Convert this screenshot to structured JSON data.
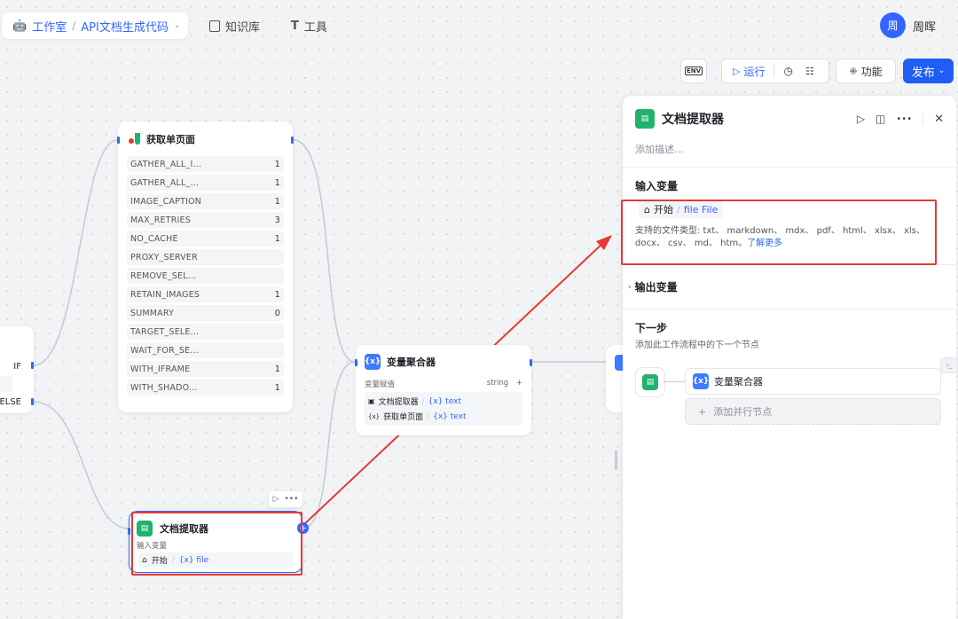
{
  "topbar": {
    "studio": "工作室",
    "separator": "/",
    "project": "API文档生成代码",
    "knowledge": "知识库",
    "tools": "工具",
    "avatar_char": "周",
    "username": "周晖"
  },
  "toolbar": {
    "env": "ENV",
    "run": "运行",
    "features": "功能",
    "publish": "发布"
  },
  "fetch_node": {
    "title": "获取单页面",
    "params": [
      {
        "name": "GATHER_ALL_I...",
        "value": "1"
      },
      {
        "name": "GATHER_ALL_...",
        "value": "1"
      },
      {
        "name": "IMAGE_CAPTION",
        "value": "1"
      },
      {
        "name": "MAX_RETRIES",
        "value": "3"
      },
      {
        "name": "NO_CACHE",
        "value": "1"
      },
      {
        "name": "PROXY_SERVER",
        "value": ""
      },
      {
        "name": "REMOVE_SEL...",
        "value": ""
      },
      {
        "name": "RETAIN_IMAGES",
        "value": "1"
      },
      {
        "name": "SUMMARY",
        "value": "0"
      },
      {
        "name": "TARGET_SELE...",
        "value": ""
      },
      {
        "name": "WAIT_FOR_SE...",
        "value": ""
      },
      {
        "name": "WITH_IFRAME",
        "value": "1"
      },
      {
        "name": "WITH_SHADO...",
        "value": "1"
      }
    ]
  },
  "condition_node": {
    "if_label": "IF",
    "else_label": "ELSE"
  },
  "aggregator_node": {
    "title": "变量聚合器",
    "group_label": "变量赋值",
    "group_type": "string",
    "add": "+",
    "rows": [
      {
        "source": "文档提取器",
        "var": "text"
      },
      {
        "source": "获取单页面",
        "var": "text"
      }
    ]
  },
  "doc_node": {
    "title": "文档提取器",
    "input_label": "输入变量",
    "input_source": "开始",
    "input_var": "file"
  },
  "panel": {
    "title": "文档提取器",
    "description_placeholder": "添加描述...",
    "input_heading": "输入变量",
    "input_source": "开始",
    "input_sep": "/",
    "input_var": "file File",
    "supported_types_prefix": "支持的文件类型: txt、 markdown、 mdx、 pdf、 html、 xlsx、 xls、",
    "supported_types_line2": "docx、 csv、 md、 htm。",
    "learn_more": "了解更多",
    "output_heading": "输出变量",
    "next_heading": "下一步",
    "next_desc": "添加此工作流程中的下一个节点",
    "next_node": "变量聚合器",
    "add_parallel": "添加并行节点"
  },
  "colors": {
    "accent": "#3366ff",
    "publish": "#1f5ef5",
    "highlight": "#e53935",
    "node_green": "#21b26c"
  }
}
